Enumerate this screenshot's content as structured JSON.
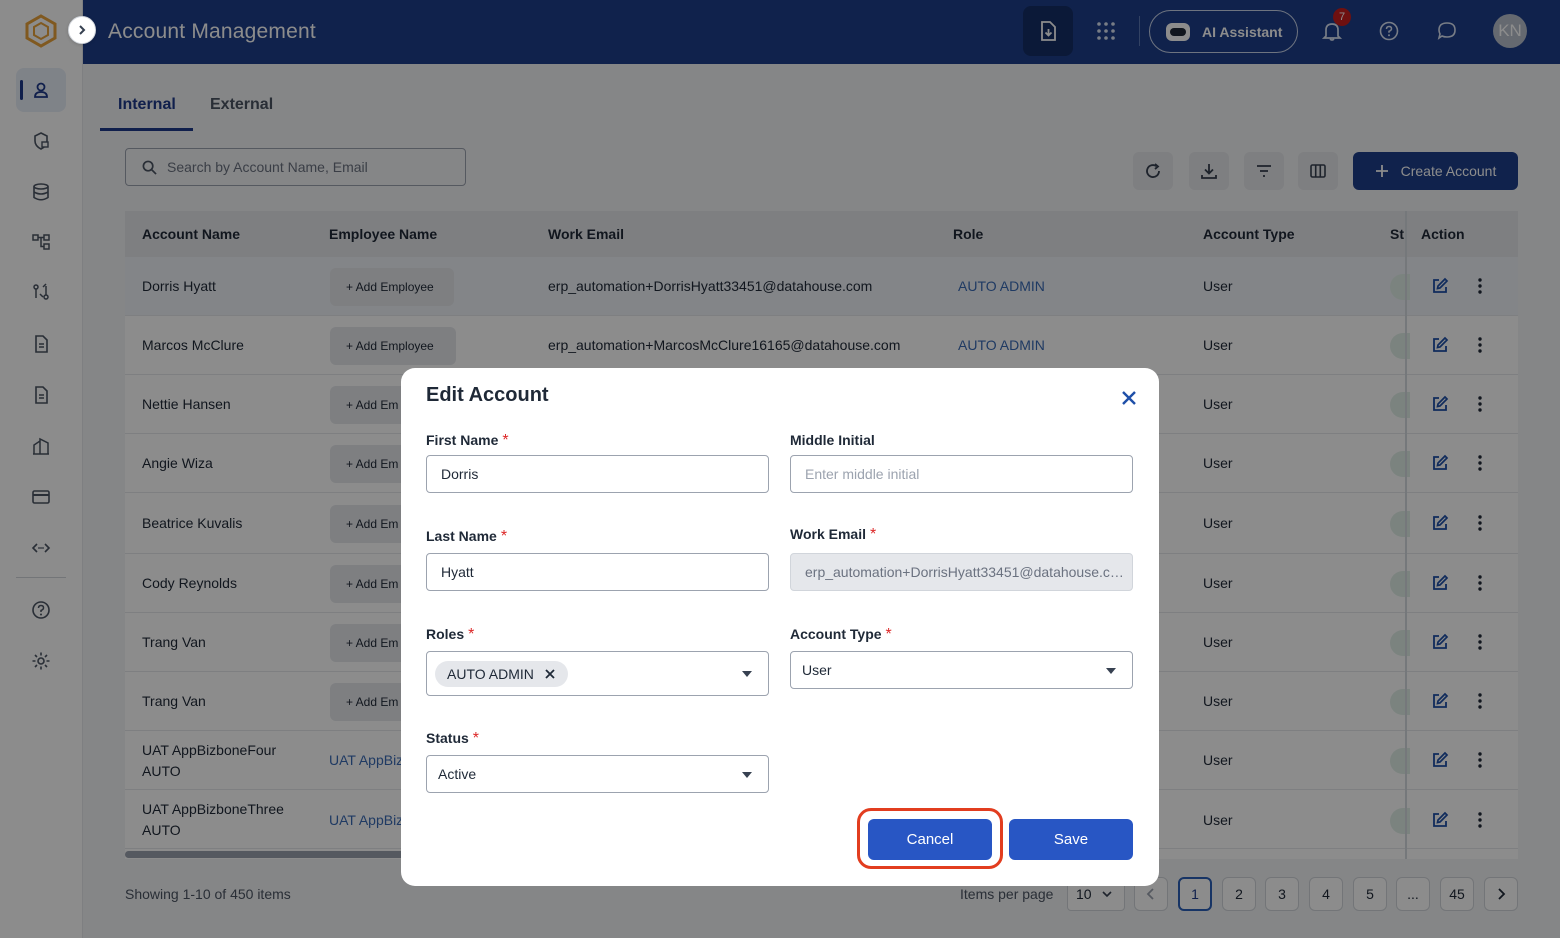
{
  "header": {
    "title": "Account Management",
    "ai_assistant_label": "AI Assistant",
    "notification_count": "7",
    "avatar_initials": "KN",
    "brand_color": "#1e3f8a"
  },
  "tabs": [
    {
      "label": "Internal",
      "active": true
    },
    {
      "label": "External",
      "active": false
    }
  ],
  "search": {
    "placeholder": "Search by Account Name, Email"
  },
  "toolbar": {
    "create_label": "Create Account"
  },
  "table": {
    "columns": [
      "Account Name",
      "Employee Name",
      "Work Email",
      "Role",
      "Account Type",
      "St",
      "Action"
    ],
    "add_employee_label": "Add Employee",
    "rows": [
      {
        "account": "Dorris Hyatt",
        "employee": "+ Add Employee",
        "email": "erp_automation+DorrisHyatt33451@datahouse.com",
        "role": "AUTO ADMIN",
        "type": "User"
      },
      {
        "account": "Marcos McClure",
        "employee": "+ Add Employee",
        "email": "erp_automation+MarcosMcClure16165@datahouse.com",
        "role": "AUTO ADMIN",
        "type": "User"
      },
      {
        "account": "Nettie Hansen",
        "employee": "+ Add Em",
        "email": "",
        "role": "",
        "type": "User"
      },
      {
        "account": "Angie Wiza",
        "employee": "+ Add Em",
        "email": "",
        "role": "",
        "type": "User"
      },
      {
        "account": "Beatrice Kuvalis",
        "employee": "+ Add Em",
        "email": "",
        "role": "",
        "type": "User"
      },
      {
        "account": "Cody Reynolds",
        "employee": "+ Add Em",
        "email": "",
        "role": "",
        "type": "User"
      },
      {
        "account": "Trang Van",
        "employee": "+ Add Em",
        "email": "",
        "role": "",
        "type": "User"
      },
      {
        "account": "Trang Van",
        "employee": "+ Add Em",
        "email": "",
        "role": "",
        "type": "User"
      },
      {
        "account_line1": "UAT AppBizboneFour",
        "account_line2": "AUTO",
        "employee": "UAT AppBiz",
        "email": "",
        "role": "",
        "type": "User"
      },
      {
        "account_line1": "UAT AppBizboneThree",
        "account_line2": "AUTO",
        "employee": "UAT AppBiz",
        "email": "",
        "role": "",
        "type": "User"
      }
    ]
  },
  "footer": {
    "showing": "Showing 1-10 of 450 items",
    "items_per_page_label": "Items per page",
    "items_per_page_value": "10",
    "pages": [
      "1",
      "2",
      "3",
      "4",
      "5",
      "...",
      "45"
    ],
    "current_page": "1"
  },
  "modal": {
    "title": "Edit Account",
    "first_name_label": "First Name",
    "first_name_value": "Dorris",
    "middle_initial_label": "Middle Initial",
    "middle_initial_placeholder": "Enter middle initial",
    "last_name_label": "Last Name",
    "last_name_value": "Hyatt",
    "work_email_label": "Work Email",
    "work_email_value": "erp_automation+DorrisHyatt33451@datahouse.com",
    "roles_label": "Roles",
    "roles_value": "AUTO ADMIN",
    "account_type_label": "Account Type",
    "account_type_value": "User",
    "status_label": "Status",
    "status_value": "Active",
    "required_mark": "*",
    "cancel_label": "Cancel",
    "save_label": "Save",
    "highlight_color": "#e23d1f"
  }
}
